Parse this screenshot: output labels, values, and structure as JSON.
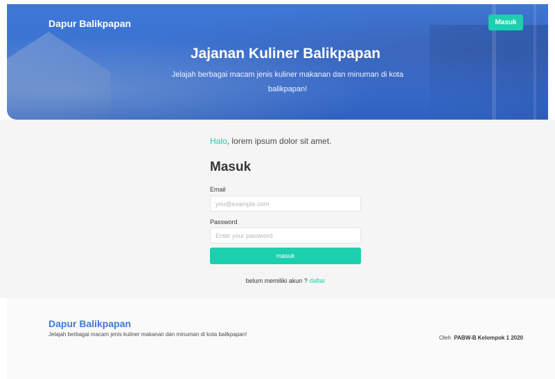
{
  "header": {
    "brand": "Dapur Balikpapan",
    "login_button": "Masuk",
    "title": "Jajanan Kuliner Balikpapan",
    "subtitle": "Jelajah berbagai macam jenis kuliner makanan dan minuman di kota balikpapan!"
  },
  "main": {
    "greeting_highlight": "Halo",
    "greeting_rest": ", lorem ipsum dolor sit amet.",
    "form_title": "Masuk",
    "email_label": "Email",
    "email_placeholder": "you@example.com",
    "email_value": "",
    "password_label": "Password",
    "password_placeholder": "Enter your password",
    "password_value": "",
    "submit_label": "masuk",
    "signup_text": "belum memiliki akun ?",
    "signup_link": "daftar"
  },
  "footer": {
    "brand": "Dapur Balikpapan",
    "description": "Jelajah berbagai macam jenis kuliner makanan dan minuman di kota balikpapan!",
    "credit_prefix": "Oleh",
    "credit_team": "PABW-B Kelompok 1 2020"
  },
  "colors": {
    "accent": "#1ccfae",
    "hero_blue": "#3e78d6"
  }
}
